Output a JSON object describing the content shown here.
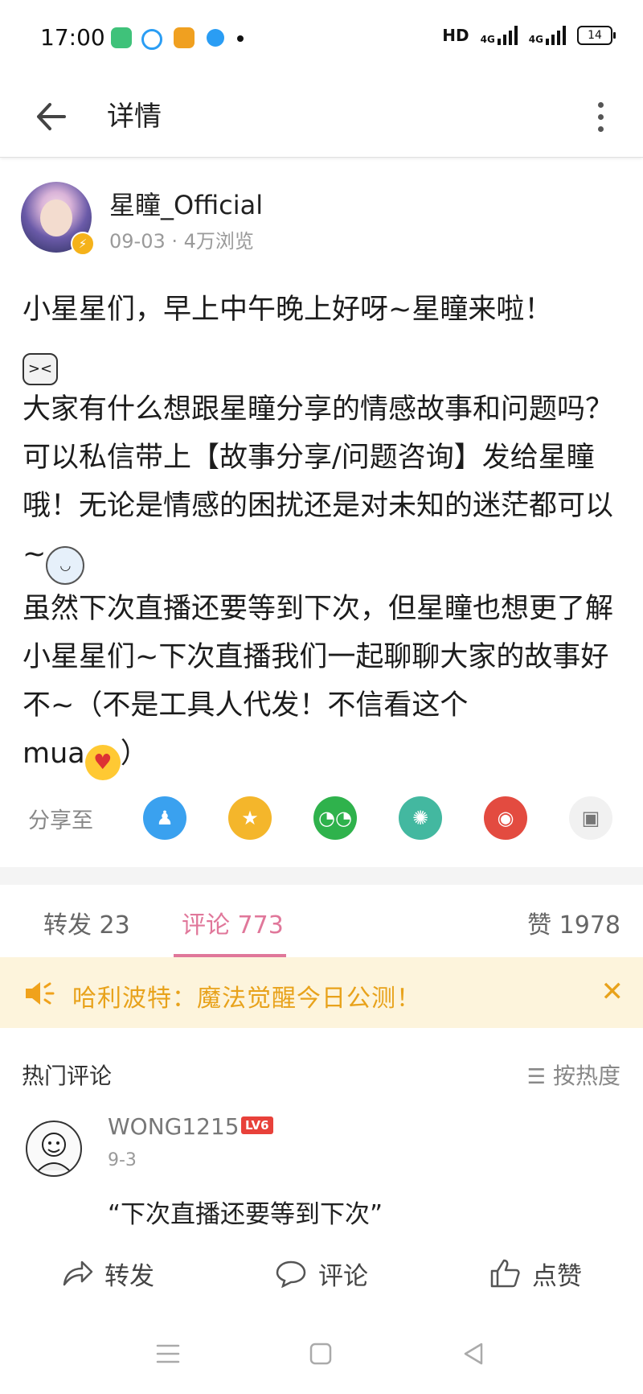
{
  "status_bar": {
    "time": "17:00",
    "network_label": "HD",
    "signal_4g_1": "4G",
    "signal_4g_2": "4G",
    "battery": "14"
  },
  "app_bar": {
    "title": "详情"
  },
  "post": {
    "author_name": "星瞳_Official",
    "meta": "09-03 · 4万浏览",
    "paragraph_1": "小星星们，早上中午晚上好呀~星瞳来啦！",
    "paragraph_2": "大家有什么想跟星瞳分享的情感故事和问题吗？可以私信带上【故事分享/问题咨询】发给星瞳哦！无论是情感的困扰还是对未知的迷茫都可以~",
    "paragraph_3a": "虽然下次直播还要等到下次，但星瞳也想更了解小星星们~下次直播我们一起聊聊大家的故事好不~（不是工具人代发！不信看这个",
    "paragraph_3b": "mua",
    "paragraph_3c": "）"
  },
  "share": {
    "label": "分享至",
    "icons": [
      "qq-icon",
      "qzone-icon",
      "wechat-icon",
      "moments-icon",
      "weibo-icon",
      "gallery-icon"
    ]
  },
  "tabs": {
    "repost": "转发 23",
    "comments": "评论 773",
    "likes": "赞 1978"
  },
  "banner": {
    "text": "哈利波特：魔法觉醒今日公测！",
    "close": "✕"
  },
  "comments_section": {
    "title": "热门评论",
    "sort_label": "按热度",
    "items": [
      {
        "user": "WONG1215",
        "level": "LV6",
        "date": "9-3",
        "text": "“下次直播还要等到下次”"
      }
    ]
  },
  "actions": {
    "repost": "转发",
    "comment": "评论",
    "like": "点赞"
  },
  "colors": {
    "accent_pink": "#e0779a",
    "banner_bg": "#fdf4dc",
    "banner_text": "#e8a21b",
    "level_badge": "#e8413a"
  }
}
